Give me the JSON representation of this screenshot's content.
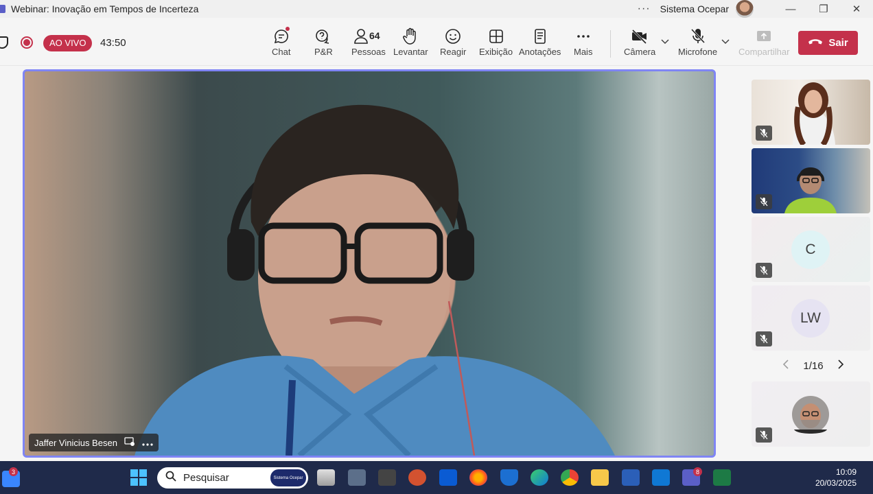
{
  "window": {
    "title": "Webinar: Inovação em Tempos de Incerteza",
    "org_name": "Sistema Ocepar",
    "more_dots": "···",
    "minimize": "—",
    "maximize": "❐",
    "close": "✕"
  },
  "meeting": {
    "live_label": "AO VIVO",
    "timer": "43:50",
    "people_count": "64",
    "leave_label": "Sair"
  },
  "toolbar": [
    {
      "label": "Chat",
      "icon": "chat-icon"
    },
    {
      "label": "P&R",
      "icon": "qa-icon"
    },
    {
      "label": "Pessoas",
      "icon": "people-icon"
    },
    {
      "label": "Levantar",
      "icon": "raise-hand-icon"
    },
    {
      "label": "Reagir",
      "icon": "react-icon"
    },
    {
      "label": "Exibição",
      "icon": "view-icon"
    },
    {
      "label": "Anotações",
      "icon": "notes-icon"
    },
    {
      "label": "Mais",
      "icon": "more-icon"
    },
    {
      "label": "Câmera",
      "icon": "camera-off-icon"
    },
    {
      "label": "Microfone",
      "icon": "mic-off-icon"
    },
    {
      "label": "Compartilhar",
      "icon": "share-icon"
    }
  ],
  "speaker": {
    "name": "Jaffer Vinicius Besen"
  },
  "participants": [
    {
      "kind": "video",
      "muted": true
    },
    {
      "kind": "video",
      "muted": true
    },
    {
      "kind": "initials",
      "initials": "C",
      "color": "#dff3f5",
      "muted": true
    },
    {
      "kind": "initials",
      "initials": "LW",
      "color": "#e6e3f2",
      "muted": true
    },
    {
      "kind": "video",
      "muted": true
    }
  ],
  "pager": {
    "text": "1/16"
  },
  "taskbar": {
    "search_placeholder": "Pesquisar",
    "search_banner": "Sistema Ocepar",
    "widgets_badge": "3",
    "teams_badge": "8",
    "time": "10:09",
    "date": "20/03/2025"
  }
}
